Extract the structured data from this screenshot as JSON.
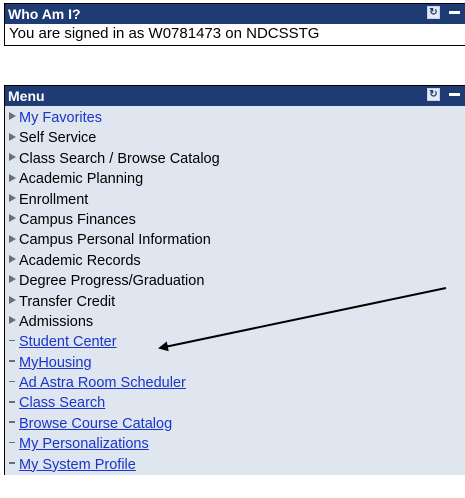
{
  "who_am_i": {
    "title": "Who Am I?",
    "signed_in_text": "You are signed in as W0781473 on NDCSSTG"
  },
  "menu": {
    "title": "Menu",
    "items": [
      {
        "label": "My Favorites",
        "kind": "folder",
        "style": "favorite"
      },
      {
        "label": "Self Service",
        "kind": "folder"
      },
      {
        "label": "Class Search / Browse Catalog",
        "kind": "folder"
      },
      {
        "label": "Academic Planning",
        "kind": "folder"
      },
      {
        "label": "Enrollment",
        "kind": "folder"
      },
      {
        "label": "Campus Finances",
        "kind": "folder"
      },
      {
        "label": "Campus Personal Information",
        "kind": "folder"
      },
      {
        "label": "Academic Records",
        "kind": "folder"
      },
      {
        "label": "Degree Progress/Graduation",
        "kind": "folder"
      },
      {
        "label": "Transfer Credit",
        "kind": "folder"
      },
      {
        "label": "Admissions",
        "kind": "folder"
      },
      {
        "label": "Student Center",
        "kind": "link"
      },
      {
        "label": "MyHousing",
        "kind": "link"
      },
      {
        "label": "Ad Astra Room Scheduler",
        "kind": "link"
      },
      {
        "label": "Class Search",
        "kind": "link"
      },
      {
        "label": "Browse Course Catalog",
        "kind": "link"
      },
      {
        "label": "My Personalizations",
        "kind": "link"
      },
      {
        "label": "My System Profile",
        "kind": "link"
      }
    ]
  },
  "icons": {
    "refresh": "refresh-icon",
    "minimize": "minimize-icon"
  },
  "colors": {
    "header_bg": "#1f3b73",
    "menu_bg": "#dfe6ef",
    "link": "#1a35c9"
  }
}
